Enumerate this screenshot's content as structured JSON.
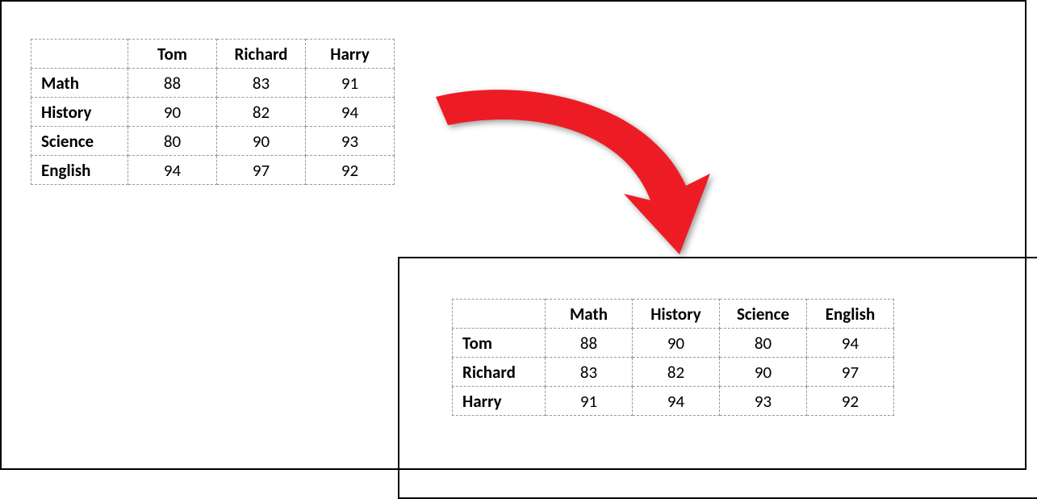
{
  "chart_data": [
    {
      "type": "table",
      "columns": [
        "Tom",
        "Richard",
        "Harry"
      ],
      "rows": [
        "Math",
        "History",
        "Science",
        "English"
      ],
      "values": [
        [
          88,
          83,
          91
        ],
        [
          90,
          82,
          94
        ],
        [
          80,
          90,
          93
        ],
        [
          94,
          97,
          92
        ]
      ]
    },
    {
      "type": "table",
      "columns": [
        "Math",
        "History",
        "Science",
        "English"
      ],
      "rows": [
        "Tom",
        "Richard",
        "Harry"
      ],
      "values": [
        [
          88,
          90,
          80,
          94
        ],
        [
          83,
          82,
          90,
          97
        ],
        [
          91,
          94,
          93,
          92
        ]
      ]
    }
  ],
  "table1": {
    "col_headers": [
      "Tom",
      "Richard",
      "Harry"
    ],
    "row_headers": [
      "Math",
      "History",
      "Science",
      "English"
    ],
    "data": {
      "r0c0": "88",
      "r0c1": "83",
      "r0c2": "91",
      "r1c0": "90",
      "r1c1": "82",
      "r1c2": "94",
      "r2c0": "80",
      "r2c1": "90",
      "r2c2": "93",
      "r3c0": "94",
      "r3c1": "97",
      "r3c2": "92"
    }
  },
  "table2": {
    "col_headers": [
      "Math",
      "History",
      "Science",
      "English"
    ],
    "row_headers": [
      "Tom",
      "Richard",
      "Harry"
    ],
    "data": {
      "r0c0": "88",
      "r0c1": "90",
      "r0c2": "80",
      "r0c3": "94",
      "r1c0": "83",
      "r1c1": "82",
      "r1c2": "90",
      "r1c3": "97",
      "r2c0": "91",
      "r2c1": "94",
      "r2c2": "93",
      "r2c3": "92"
    }
  },
  "colors": {
    "arrow": "#ED1C24"
  }
}
